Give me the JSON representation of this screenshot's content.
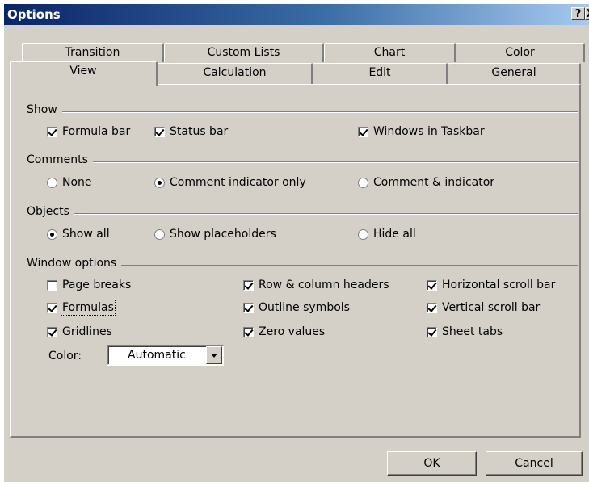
{
  "window": {
    "title": "Options",
    "help_label": "?",
    "close_label": "X"
  },
  "tabs": {
    "row1": [
      "Transition",
      "Custom Lists",
      "Chart",
      "Color"
    ],
    "row2": [
      "View",
      "Calculation",
      "Edit",
      "General"
    ],
    "active": "View"
  },
  "show": {
    "label": "Show",
    "formula_bar": "Formula bar",
    "status_bar": "Status bar",
    "windows_taskbar": "Windows in Taskbar"
  },
  "comments": {
    "label": "Comments",
    "none": "None",
    "indicator_only": "Comment indicator only",
    "comment_indicator": "Comment & indicator"
  },
  "objects": {
    "label": "Objects",
    "show_all": "Show all",
    "show_placeholders": "Show placeholders",
    "hide_all": "Hide all"
  },
  "window_options": {
    "label": "Window options",
    "page_breaks": "Page breaks",
    "formulas": "Formulas",
    "gridlines": "Gridlines",
    "row_column_headers": "Row & column headers",
    "outline_symbols": "Outline symbols",
    "zero_values": "Zero values",
    "horizontal_scroll": "Horizontal scroll bar",
    "vertical_scroll": "Vertical scroll bar",
    "sheet_tabs": "Sheet tabs",
    "color_label": "Color:",
    "color_value": "Automatic"
  },
  "buttons": {
    "ok": "OK",
    "cancel": "Cancel"
  }
}
